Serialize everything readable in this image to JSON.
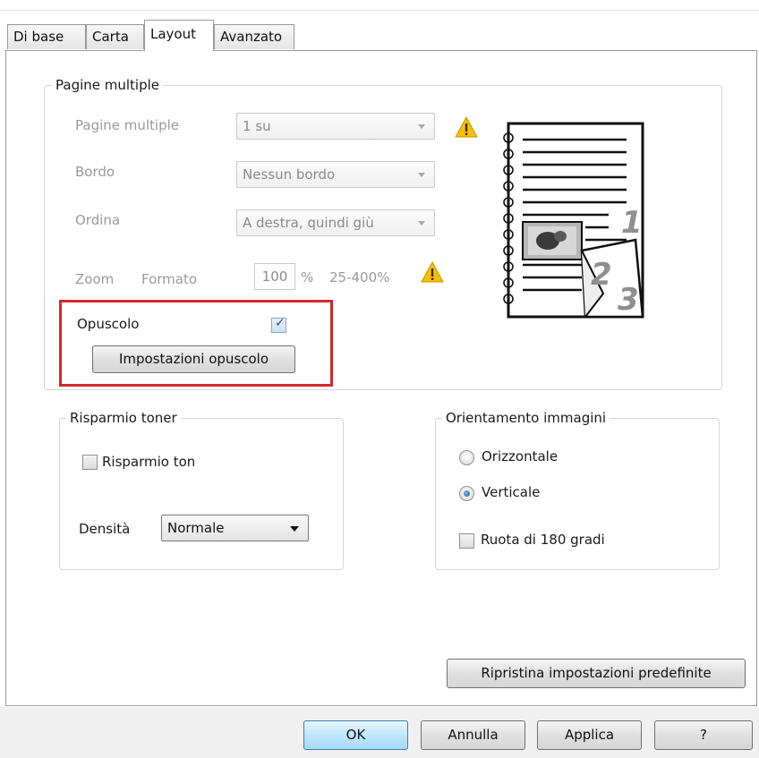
{
  "tabs": [
    {
      "label": "Di base"
    },
    {
      "label": "Carta"
    },
    {
      "label": "Layout",
      "active": true
    },
    {
      "label": "Avanzato"
    }
  ],
  "pagine_multiple": {
    "group_title": "Pagine multiple",
    "pages_label": "Pagine multiple",
    "pages_value": "1 su",
    "border_label": "Bordo",
    "border_value": "Nessun bordo",
    "order_label": "Ordina",
    "order_value": "A destra, quindi giù",
    "zoom_label": "Zoom",
    "format_label": "Formato",
    "zoom_value": "100",
    "percent": "%",
    "zoom_range": "25-400%",
    "opuscolo_label": "Opuscolo",
    "opuscolo_checked": true,
    "opuscolo_settings_button": "Impostazioni opuscolo",
    "preview_page_numbers": [
      "1",
      "2",
      "3"
    ]
  },
  "risparmio_toner": {
    "group_title": "Risparmio toner",
    "checkbox_label": "Risparmio ton",
    "checked": false,
    "density_label": "Densità",
    "density_value": "Normale"
  },
  "orientamento": {
    "group_title": "Orientamento immagini",
    "options": [
      {
        "label": "Orizzontale",
        "selected": false
      },
      {
        "label": "Verticale",
        "selected": true
      }
    ],
    "rotate_label": "Ruota di 180 gradi",
    "rotate_checked": false
  },
  "restore_defaults_button": "Ripristina impostazioni predefinite",
  "footer_buttons": {
    "ok": "OK",
    "cancel": "Annulla",
    "apply": "Applica",
    "help": "?"
  },
  "colors": {
    "highlight_border": "#d4272e",
    "warning_fill": "#f5c000",
    "checkmark": "#2b4f85"
  }
}
